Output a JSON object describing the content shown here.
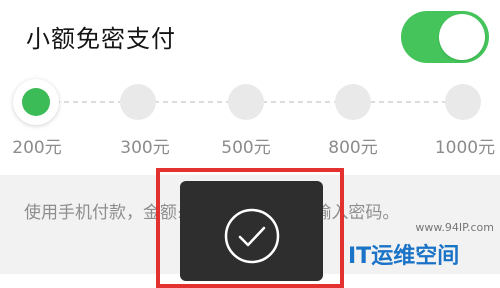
{
  "setting": {
    "title": "小额免密支付",
    "toggle_on": true
  },
  "amounts": {
    "options": [
      "200元",
      "300元",
      "500元",
      "800元",
      "1000元"
    ],
    "selected_index": 0
  },
  "description": "使用手机付款，金额≤500元/日，无需输入密码。",
  "toast": {
    "icon": "check-icon"
  },
  "watermark": {
    "url": "www.94IP.com",
    "text": "IT运维空间"
  },
  "colors": {
    "accent": "#44c45a",
    "highlight": "#e3312f",
    "toast_bg": "#2e2e2e"
  }
}
